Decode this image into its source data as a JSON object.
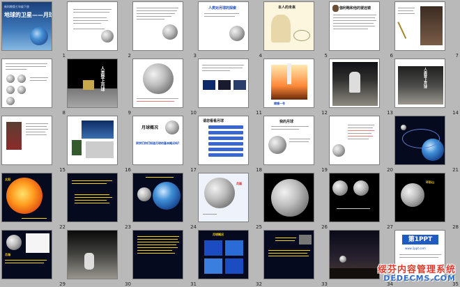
{
  "slides": [
    {
      "n": "1",
      "title": "地球的卫星——月球",
      "subtitle": "新科教版七年级下册"
    },
    {
      "n": "2",
      "title": "学习目标"
    },
    {
      "n": "3",
      "title": "月球"
    },
    {
      "n": "4",
      "title": "人类对月球的探索"
    },
    {
      "n": "5",
      "title": "本人的未来"
    },
    {
      "n": "6",
      "title": "伽利略和他的望远镜"
    },
    {
      "n": "7",
      "title": ""
    },
    {
      "n": "8",
      "title": ""
    },
    {
      "n": "9",
      "title": "人类登上月球"
    },
    {
      "n": "10",
      "title": ""
    },
    {
      "n": "11",
      "title": ""
    },
    {
      "n": "12",
      "title": "嫦娥一号"
    },
    {
      "n": "13",
      "title": ""
    },
    {
      "n": "14",
      "title": "人类登上月球"
    },
    {
      "n": "15",
      "title": ""
    },
    {
      "n": "16",
      "title": ""
    },
    {
      "n": "17",
      "title": "月球概况",
      "subtitle": "同学们你们知道月球的基本概况吗?"
    },
    {
      "n": "18",
      "title": "请您看看月球"
    },
    {
      "n": "19",
      "title": "我的月球"
    },
    {
      "n": "20",
      "title": ""
    },
    {
      "n": "21",
      "title": ""
    },
    {
      "n": "22",
      "title": "太阳"
    },
    {
      "n": "23",
      "title": ""
    },
    {
      "n": "24",
      "title": ""
    },
    {
      "n": "25",
      "title": "月面"
    },
    {
      "n": "26",
      "title": ""
    },
    {
      "n": "27",
      "title": ""
    },
    {
      "n": "28",
      "title": "环形山"
    },
    {
      "n": "29",
      "title": "月海"
    },
    {
      "n": "30",
      "title": ""
    },
    {
      "n": "31",
      "title": ""
    },
    {
      "n": "32",
      "title": "月球概况"
    },
    {
      "n": "33",
      "title": ""
    },
    {
      "n": "34",
      "title": ""
    },
    {
      "n": "35",
      "title": "第1PPT",
      "subtitle": "www.1ppt.com"
    }
  ],
  "watermark": {
    "cn": "绥芬内容管理系统",
    "en": "DEDECMS.COM"
  },
  "colors": {
    "background": "#b9b9b9",
    "accent": "#1f5bc0",
    "space": "#050a1e"
  }
}
